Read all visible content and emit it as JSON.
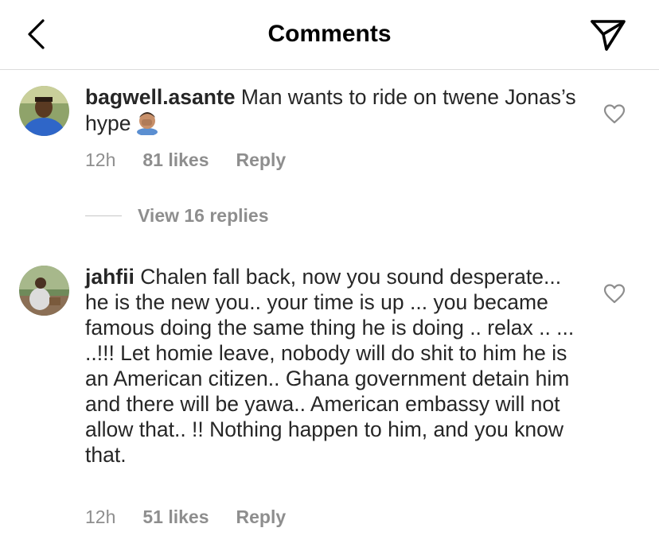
{
  "header": {
    "title": "Comments",
    "back_icon": "chevron-left-icon",
    "share_icon": "paper-plane-icon"
  },
  "comments": [
    {
      "username": "bagwell.asante",
      "text": " Man wants to ride on twene Jonas’s hype",
      "emoji": "face-palm-emoji",
      "time": "12h",
      "likes": "81 likes",
      "reply": "Reply",
      "view_replies": "View 16 replies"
    },
    {
      "username": "jahfii",
      "text": " Chalen fall back, now you sound desperate... he is the new you.. your time is up ... you became famous doing the same thing he is doing .. relax .. ... ..!!! Let homie leave, nobody will do shit to him he is an American citizen.. Ghana government detain him and there will be yawa.. American embassy will not allow that.. !! Nothing happen to him, and you know that.",
      "time": "12h",
      "likes": "51 likes",
      "reply": "Reply"
    }
  ],
  "colors": {
    "text": "#262626",
    "muted": "#8e8e8e",
    "divider": "#dbdbdb"
  }
}
